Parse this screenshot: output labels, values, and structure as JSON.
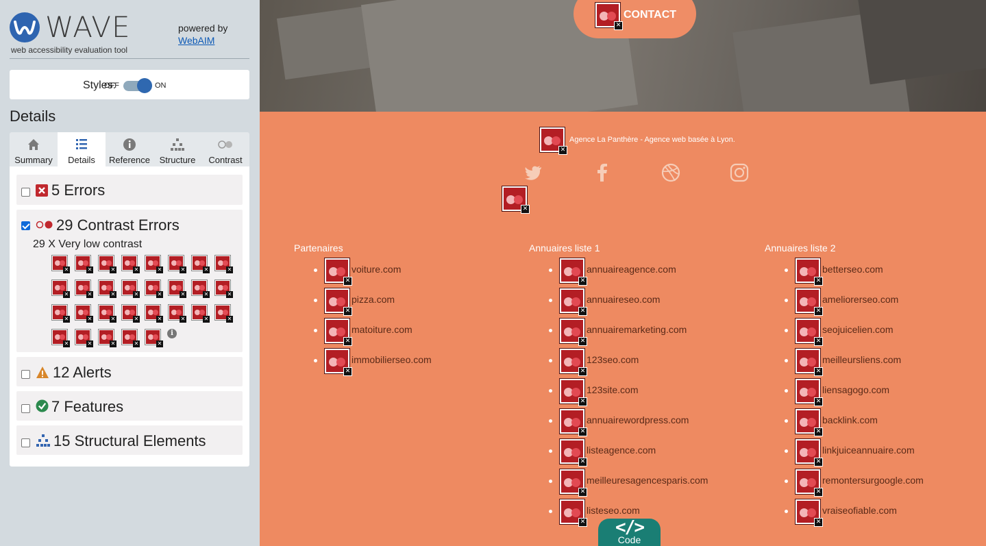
{
  "sidebar": {
    "logo_word": "WAVE",
    "logo_tagline": "web accessibility evaluation tool",
    "powered_by": "powered by",
    "powered_link": "WebAIM",
    "styles_label": "Styles:",
    "styles_off": "OFF",
    "styles_on": "ON",
    "styles_state": "on",
    "details_heading": "Details",
    "tabs": [
      {
        "label": "Summary",
        "icon": "home-icon"
      },
      {
        "label": "Details",
        "icon": "list-icon",
        "active": true
      },
      {
        "label": "Reference",
        "icon": "info-icon"
      },
      {
        "label": "Structure",
        "icon": "structure-icon"
      },
      {
        "label": "Contrast",
        "icon": "contrast-icon"
      }
    ],
    "categories": {
      "errors": {
        "label": "5 Errors",
        "checked": false,
        "icon": "error-icon",
        "color": "#c0282e"
      },
      "contrast": {
        "label": "29 Contrast Errors",
        "checked": true,
        "icon": "contrast-error-icon",
        "sub_label": "29 X Very low contrast",
        "count": 29
      },
      "alerts": {
        "label": "12 Alerts",
        "checked": false,
        "icon": "alert-icon",
        "color": "#d8862a"
      },
      "features": {
        "label": "7 Features",
        "checked": false,
        "icon": "feature-icon",
        "color": "#2c8a4e"
      },
      "structural": {
        "label": "15 Structural Elements",
        "checked": false,
        "icon": "structure-icon",
        "color": "#3264b0"
      }
    }
  },
  "page": {
    "contact_label": "CONTACT",
    "agency_text": "Agence La Panthère - Agence web basée à Lyon.",
    "social_icons": [
      "twitter-icon",
      "facebook-icon",
      "dribbble-icon",
      "instagram-icon"
    ],
    "columns": [
      {
        "title": "Partenaires",
        "items": [
          "voiture.com",
          "pizza.com",
          "matoiture.com",
          "immobilierseo.com"
        ]
      },
      {
        "title": "Annuaires liste 1",
        "items": [
          "annuaireagence.com",
          "annuaireseo.com",
          "annuairemarketing.com",
          "123seo.com",
          "123site.com",
          "annuairewordpress.com",
          "listeagence.com",
          "meilleuresagencesparis.com",
          "listeseo.com"
        ]
      },
      {
        "title": "Annuaires liste 2",
        "items": [
          "betterseo.com",
          "ameliorerseo.com",
          "seojuicelien.com",
          "meilleursliens.com",
          "liensagogo.com",
          "backlink.com",
          "linkjuiceannuaire.com",
          "remontersurgoogle.com",
          "vraiseofiable.com"
        ]
      }
    ],
    "code_label": "Code",
    "code_glyph": "</>",
    "accent_color": "#ee8a61",
    "wave_error_color": "#b31e24"
  }
}
